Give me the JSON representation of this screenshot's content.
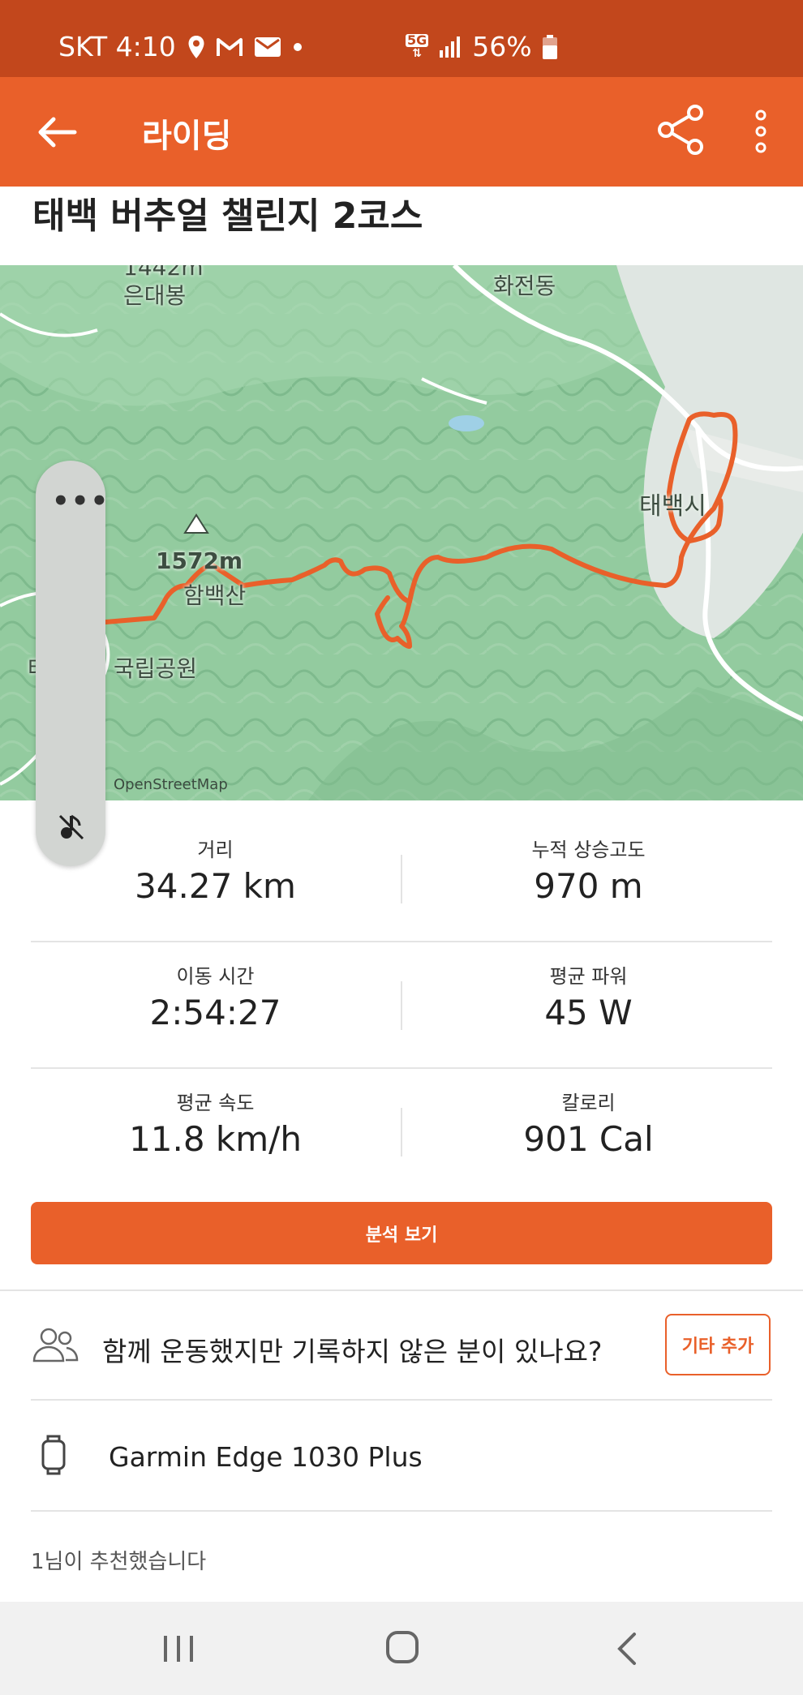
{
  "status_bar": {
    "carrier_time": "SKT 4:10",
    "network": "5G",
    "battery": "56%"
  },
  "app_bar": {
    "title": "라이딩",
    "icons": [
      "back-arrow-icon",
      "share-icon",
      "more-vertical-icon"
    ]
  },
  "activity": {
    "title": "태백 버추얼 챌린지 2코스"
  },
  "map": {
    "labels": {
      "peak_top": "1442m",
      "mountain_top": "은대봉",
      "district": "화전동",
      "city": "태백시",
      "peak": "1572m",
      "mountain": "함백산",
      "park_prefix": "태",
      "park": "국립공원"
    },
    "attribution": "OpenStreetMap",
    "route_color": "#e9602a"
  },
  "side_panel": {
    "more": "•••",
    "icons": [
      "more-horizontal-icon",
      "mute-icon"
    ]
  },
  "stats": [
    {
      "label": "거리",
      "value": "34.27 km"
    },
    {
      "label": "누적 상승고도",
      "value": "970 m"
    },
    {
      "label": "이동 시간",
      "value": "2:54:27"
    },
    {
      "label": "평균 파워",
      "value": "45 W"
    },
    {
      "label": "평균 속도",
      "value": "11.8 km/h"
    },
    {
      "label": "칼로리",
      "value": "901 Cal"
    }
  ],
  "actions": {
    "analysis_button": "분석 보기",
    "group_prompt": "함께 운동했지만 기록하지 않은 분이 있나요?",
    "add_other_button": "기타 추가"
  },
  "device": {
    "name": "Garmin Edge 1030 Plus"
  },
  "kudos": {
    "text": "1님이 추천했습니다"
  },
  "colors": {
    "status_bar": "#c2471c",
    "accent": "#e9602a"
  }
}
